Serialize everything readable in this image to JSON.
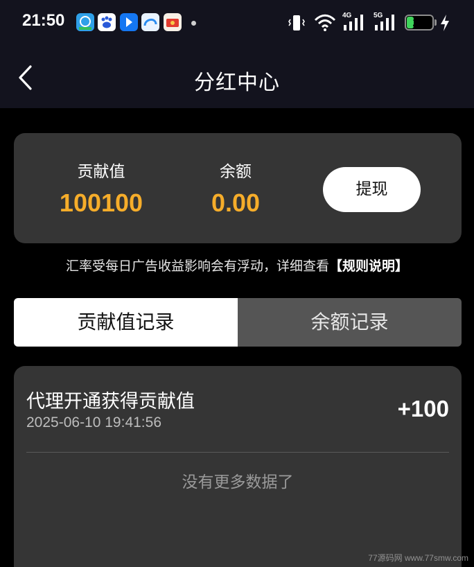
{
  "status_bar": {
    "time": "21:50",
    "network_labels": [
      "4G",
      "5G"
    ],
    "battery_level": "25",
    "battery_fraction": 0.25,
    "battery_color": "#3fd45b",
    "app_icons": [
      "app-icon-green",
      "baidu-icon",
      "bluebird-icon",
      "browser-icon",
      "red-app-icon"
    ],
    "status_icons": [
      "vibrate-icon",
      "wifi-icon",
      "signal-icon",
      "signal-icon",
      "charging-icon"
    ]
  },
  "nav": {
    "title": "分红中心",
    "back_icon": "chevron-left-icon"
  },
  "summary": {
    "contribution_label": "贡献值",
    "contribution_value": "100100",
    "balance_label": "余额",
    "balance_value": "0.00",
    "withdraw_label": "提现",
    "accent_color": "#f6ad2a"
  },
  "rule_note": {
    "text": "汇率受每日广告收益影响会有浮动，详细查看",
    "link": "【规则说明】"
  },
  "tabs": [
    {
      "label": "贡献值记录",
      "active": true
    },
    {
      "label": "余额记录",
      "active": false
    }
  ],
  "records": [
    {
      "title": "代理开通获得贡献值",
      "time": "2025-06-10 19:41:56",
      "amount": "+100"
    }
  ],
  "list_end_text": "没有更多数据了",
  "watermark": "77源码网 www.77smw.com"
}
